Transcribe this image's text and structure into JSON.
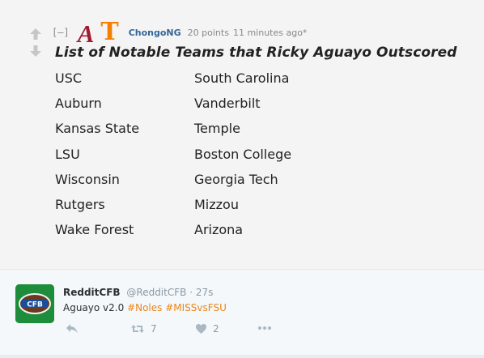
{
  "comment": {
    "collapse_label": "[–]",
    "flair_a": "A",
    "flair_t": "T",
    "author": "ChongoNG",
    "points": "20 points",
    "time": "11 minutes ago*",
    "title": "List of Notable Teams that Ricky Aguayo Outscored",
    "teams_left": [
      "USC",
      "Auburn",
      "Kansas State",
      "LSU",
      "Wisconsin",
      "Rutgers",
      "Wake Forest"
    ],
    "teams_right": [
      "South Carolina",
      "Vanderbilt",
      "Temple",
      "Boston College",
      "Georgia Tech",
      "Mizzou",
      "Arizona"
    ],
    "colors": {
      "flair_a": "#9e1b32",
      "flair_t": "#f77f00",
      "author": "#336699"
    }
  },
  "tweet": {
    "name": "RedditCFB",
    "handle": "@RedditCFB",
    "separator": "·",
    "time": "27s",
    "text_prefix": "Aguayo v2.0",
    "hashtags": [
      "#Noles",
      "#MISSvsFSU"
    ],
    "avatar_text": "CFB",
    "retweet_count": "7",
    "like_count": "2",
    "icons": [
      "reply-icon",
      "retweet-icon",
      "heart-icon",
      "more-icon"
    ],
    "colors": {
      "hashtag": "#e8861b",
      "avatar": "#1d8c3b"
    }
  }
}
